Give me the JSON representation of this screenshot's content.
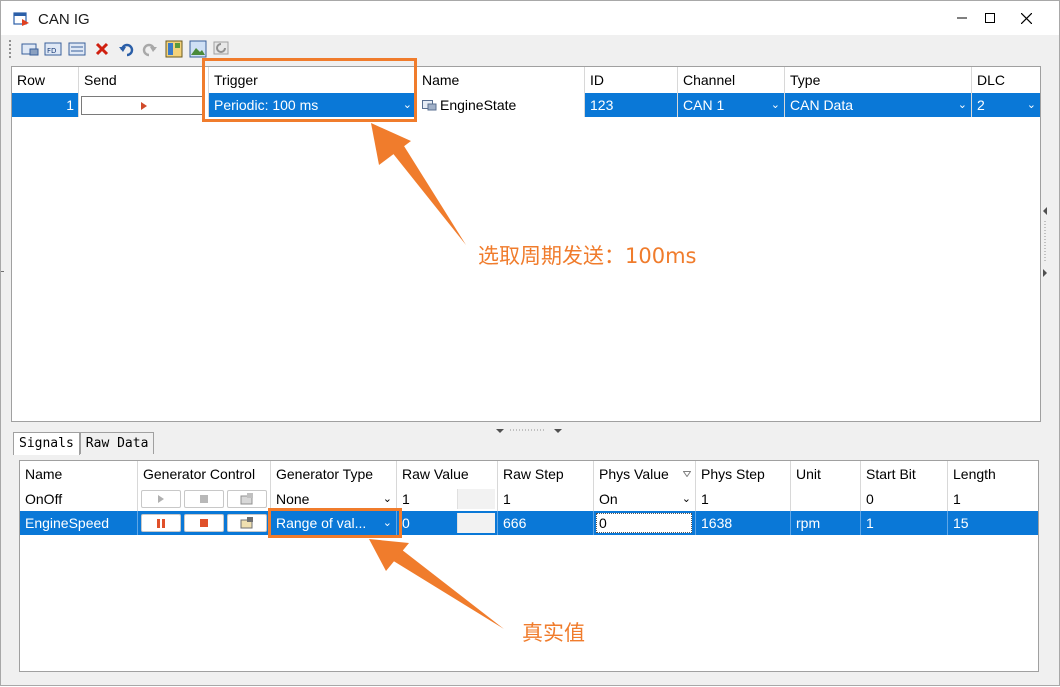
{
  "window": {
    "title": "CAN IG"
  },
  "colors": {
    "selection": "#0a78d7",
    "annotation": "#f07c2c"
  },
  "toolbar": {
    "icons": [
      "new-message-icon",
      "fd-message-icon",
      "ig-message-icon",
      "delete-icon",
      "undo-icon",
      "redo-icon",
      "layout-icon",
      "image-icon",
      "refresh-icon"
    ]
  },
  "messages": {
    "headers": [
      "Row",
      "Send",
      "Trigger",
      "Name",
      "ID",
      "Channel",
      "Type",
      "DLC"
    ],
    "row": {
      "row": "1",
      "trigger": "Periodic: 100 ms",
      "name": "EngineState",
      "id": "123",
      "channel": "CAN 1",
      "type": "CAN Data",
      "dlc": "2"
    }
  },
  "tabs": [
    "Signals",
    "Raw Data"
  ],
  "signals": {
    "headers": [
      "Name",
      "Generator Control",
      "Generator Type",
      "Raw Value",
      "Raw Step",
      "Phys Value",
      "Phys Step",
      "Unit",
      "Start Bit",
      "Length"
    ],
    "rows": [
      {
        "name": "OnOff",
        "gen_type": "None",
        "raw_value": "1",
        "raw_step": "1",
        "phys_value": "On",
        "phys_step": "1",
        "unit": "",
        "start_bit": "0",
        "length": "1"
      },
      {
        "name": "EngineSpeed",
        "gen_type": "Range of val...",
        "raw_value": "0",
        "raw_step": "666",
        "phys_value": "0",
        "phys_step": "1638",
        "unit": "rpm",
        "start_bit": "1",
        "length": "15"
      }
    ]
  },
  "annotations": {
    "trigger_note": "选取周期发送：100ms",
    "value_note": "真实值"
  }
}
